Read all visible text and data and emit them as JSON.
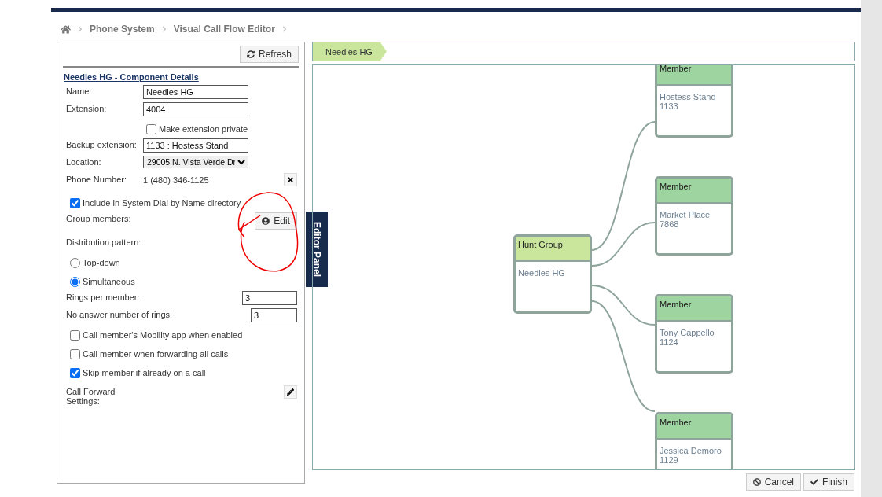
{
  "breadcrumb": [
    "Phone System",
    "Visual Call Flow Editor"
  ],
  "panel": {
    "refresh": "Refresh",
    "title": "Needles HG - Component Details",
    "rows": [
      {
        "kind": "input",
        "label": "Name:",
        "value": "Needles HG"
      },
      {
        "kind": "input",
        "label": "Extension:",
        "value": "4004"
      },
      {
        "kind": "sub_checkbox",
        "label": "Make extension private",
        "checked": false
      },
      {
        "kind": "input",
        "label": "Backup extension:",
        "value": "1133 : Hostess Stand"
      },
      {
        "kind": "select",
        "label": "Location:",
        "value": "29005 N. Vista Verde Dr"
      },
      {
        "kind": "phone",
        "label": "Phone Number:",
        "value": "1 (480) 346-1125"
      },
      {
        "kind": "checkbox",
        "label": "Include in System Dial by Name directory",
        "checked": true
      },
      {
        "kind": "members",
        "label": "Group members:",
        "button": "Edit"
      },
      {
        "kind": "heading",
        "label": "Distribution pattern:"
      },
      {
        "kind": "radio",
        "label": "Top-down",
        "selected": false
      },
      {
        "kind": "radio",
        "label": "Simultaneous",
        "selected": true
      },
      {
        "kind": "short_input",
        "label": "Rings per member:",
        "value": "3"
      },
      {
        "kind": "short_input",
        "label": "No answer number of rings:",
        "value": "3"
      },
      {
        "kind": "checkbox",
        "label": "Call member's Mobility app when enabled",
        "checked": false
      },
      {
        "kind": "checkbox",
        "label": "Call member when forwarding all calls",
        "checked": false
      },
      {
        "kind": "checkbox",
        "label": "Skip member if already on a call",
        "checked": true
      },
      {
        "kind": "settings",
        "label": "Call Forward Settings:"
      }
    ]
  },
  "editor_tab": "Editor Panel",
  "flow_tab": "Needles HG",
  "nodes": [
    {
      "kind": "hunt_group",
      "header": "Hunt Group",
      "name": "Needles HG"
    },
    {
      "kind": "member",
      "header": "Member",
      "name": "Hostess Stand",
      "extension": "1133"
    },
    {
      "kind": "member",
      "header": "Member",
      "name": "Market Place",
      "extension": "7868"
    },
    {
      "kind": "member",
      "header": "Member",
      "name": "Tony Cappello",
      "extension": "1124"
    },
    {
      "kind": "member",
      "header": "Member",
      "name": "Jessica Demoro",
      "extension": "1129"
    }
  ],
  "buttons": [
    "Cancel",
    "Finish"
  ]
}
